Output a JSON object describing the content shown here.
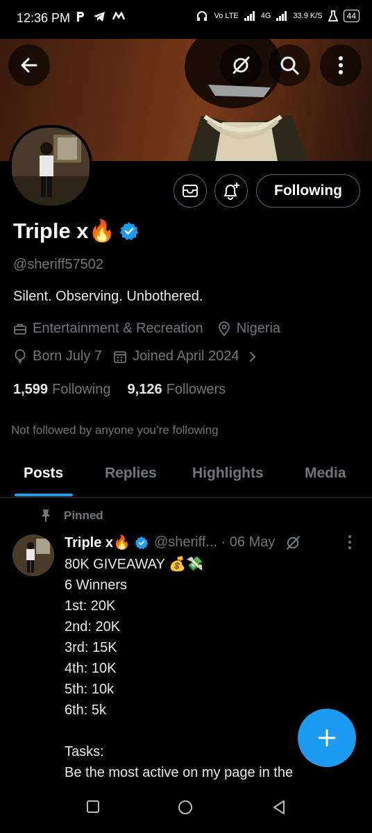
{
  "status_bar": {
    "time": "12:36 PM",
    "network_labels": [
      "Vo LTE",
      "4G",
      "33.9 K/S"
    ],
    "battery": "44"
  },
  "profile": {
    "name": "Triple x🔥",
    "handle": "@sheriff57502",
    "bio": "Silent. Observing. Unbothered.",
    "category": "Entertainment & Recreation",
    "location": "Nigeria",
    "birthday": "Born July 7",
    "joined": "Joined April 2024",
    "following_count": "1,599",
    "following_label": "Following",
    "followers_count": "9,126",
    "followers_label": "Followers",
    "not_followed_text": "Not followed by anyone you’re following",
    "follow_button_label": "Following",
    "verified_color": "#1d9bf0"
  },
  "tabs": [
    {
      "label": "Posts",
      "active": true
    },
    {
      "label": "Replies",
      "active": false
    },
    {
      "label": "Highlights",
      "active": false
    },
    {
      "label": "Media",
      "active": false
    }
  ],
  "pinned_post": {
    "pinned_label": "Pinned",
    "name": "Triple x🔥",
    "handle_date": "@sheriff... · 06 May",
    "body": "80K GIVEAWAY 💰💸\n6 Winners\n1st:  20K\n2nd: 20K\n3rd: 15K\n4th: 10K\n5th: 10k\n6th: 5k\n\nTasks:\nBe the most active on my page in the"
  },
  "icons": {
    "back": "arrow-left-icon",
    "grok": "slash-circle-icon",
    "search": "search-icon",
    "more": "more-vertical-icon",
    "message": "envelope-icon",
    "notify": "bell-plus-icon",
    "compose": "plus-icon"
  },
  "colors": {
    "accent": "#1d9bf0",
    "background": "#000000",
    "muted": "#71767b"
  }
}
